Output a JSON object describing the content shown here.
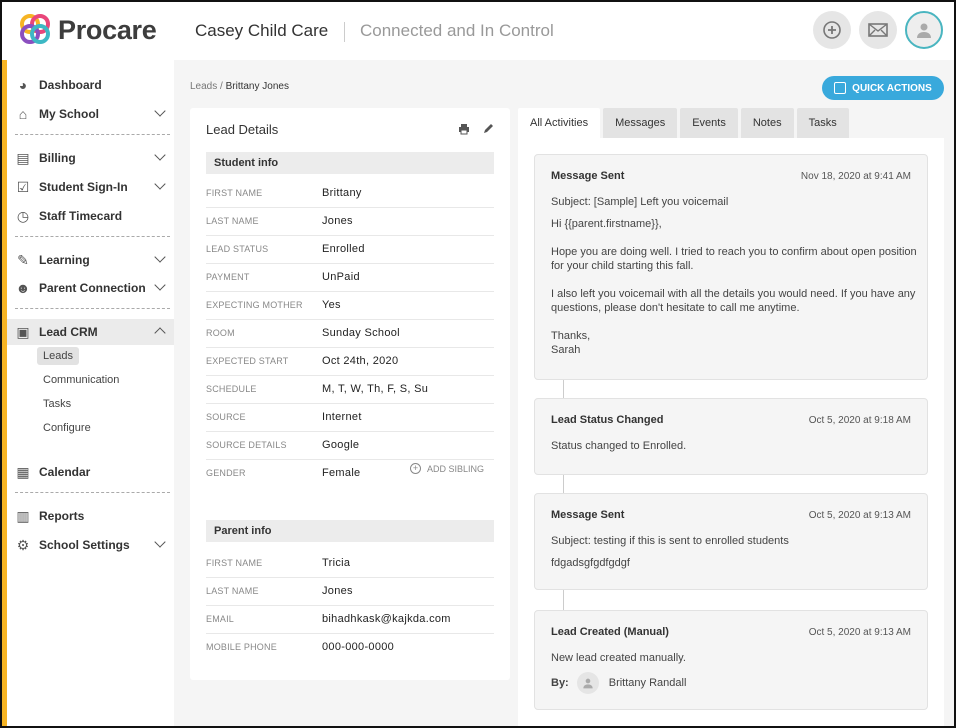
{
  "brand": {
    "name": "Procare",
    "school": "Casey Child Care",
    "tagline": "Connected and In Control"
  },
  "header_actions": [
    {
      "icon": "plus-circle-icon"
    },
    {
      "icon": "envelope-icon"
    },
    {
      "icon": "user-avatar-icon"
    }
  ],
  "sidebar": {
    "items": [
      {
        "label": "Dashboard",
        "icon": "dashboard-icon"
      },
      {
        "label": "My School",
        "icon": "school-icon"
      },
      {
        "label": "Billing",
        "icon": "billing-icon"
      },
      {
        "label": "Student Sign-In",
        "icon": "checklist-icon"
      },
      {
        "label": "Staff Timecard",
        "icon": "clock-icon"
      },
      {
        "label": "Learning",
        "icon": "learning-icon"
      },
      {
        "label": "Parent Connection",
        "icon": "family-icon"
      },
      {
        "label": "Lead CRM",
        "icon": "id-card-icon"
      },
      {
        "label": "Calendar",
        "icon": "calendar-icon"
      },
      {
        "label": "Reports",
        "icon": "report-icon"
      },
      {
        "label": "School Settings",
        "icon": "gear-icon"
      }
    ],
    "sub_items": [
      "Leads",
      "Communication",
      "Tasks",
      "Configure"
    ]
  },
  "breadcrumb": {
    "root": "Leads",
    "separator": "/",
    "current": "Brittany Jones"
  },
  "quick_actions_label": "QUICK ACTIONS",
  "lead_details": {
    "title": "Lead Details",
    "student_section": "Student info",
    "student_fields": [
      {
        "label": "FIRST NAME",
        "value": "Brittany"
      },
      {
        "label": "LAST NAME",
        "value": "Jones"
      },
      {
        "label": "LEAD STATUS",
        "value": "Enrolled"
      },
      {
        "label": "PAYMENT",
        "value": "UnPaid"
      },
      {
        "label": "EXPECTING MOTHER",
        "value": "Yes"
      },
      {
        "label": "ROOM",
        "value": "Sunday School"
      },
      {
        "label": "EXPECTED START",
        "value": "Oct 24th, 2020"
      },
      {
        "label": "SCHEDULE",
        "value": "M, T, W, Th, F, S, Su"
      },
      {
        "label": "SOURCE",
        "value": "Internet"
      },
      {
        "label": "SOURCE DETAILS",
        "value": "Google"
      },
      {
        "label": "GENDER",
        "value": "Female"
      }
    ],
    "add_sibling": "ADD SIBLING",
    "parent_section": "Parent info",
    "parent_fields": [
      {
        "label": "FIRST NAME",
        "value": "Tricia"
      },
      {
        "label": "LAST NAME",
        "value": "Jones"
      },
      {
        "label": "EMAIL",
        "value": "bihadhkask@kajkda.com"
      },
      {
        "label": "MOBILE PHONE",
        "value": "000-000-0000"
      }
    ]
  },
  "tabs": [
    "All Activities",
    "Messages",
    "Events",
    "Notes",
    "Tasks"
  ],
  "activities": [
    {
      "title": "Message Sent",
      "time": "Nov 18, 2020 at 9:41 AM",
      "lines": [
        "Subject: [Sample] Left you voicemail",
        "Hi {{parent.firstname}},",
        "Hope you are doing well. I tried to reach you to confirm about open position for your child starting this fall.",
        "I also left you voicemail with all the details you would need. If you have any questions, please don't hesitate to call me anytime.",
        "Thanks,",
        "Sarah"
      ]
    },
    {
      "title": "Lead Status Changed",
      "time": "Oct 5, 2020 at 9:18 AM",
      "lines": [
        "Status changed to Enrolled."
      ]
    },
    {
      "title": "Message Sent",
      "time": "Oct 5, 2020 at 9:13 AM",
      "lines": [
        "Subject: testing if this is sent to enrolled students",
        "fdgadsgfgdfgdgf"
      ]
    },
    {
      "title": "Lead Created (Manual)",
      "time": "Oct 5, 2020 at 9:13 AM",
      "lines": [
        "New lead created manually."
      ],
      "by_label": "By:",
      "by_name": "Brittany Randall"
    }
  ]
}
